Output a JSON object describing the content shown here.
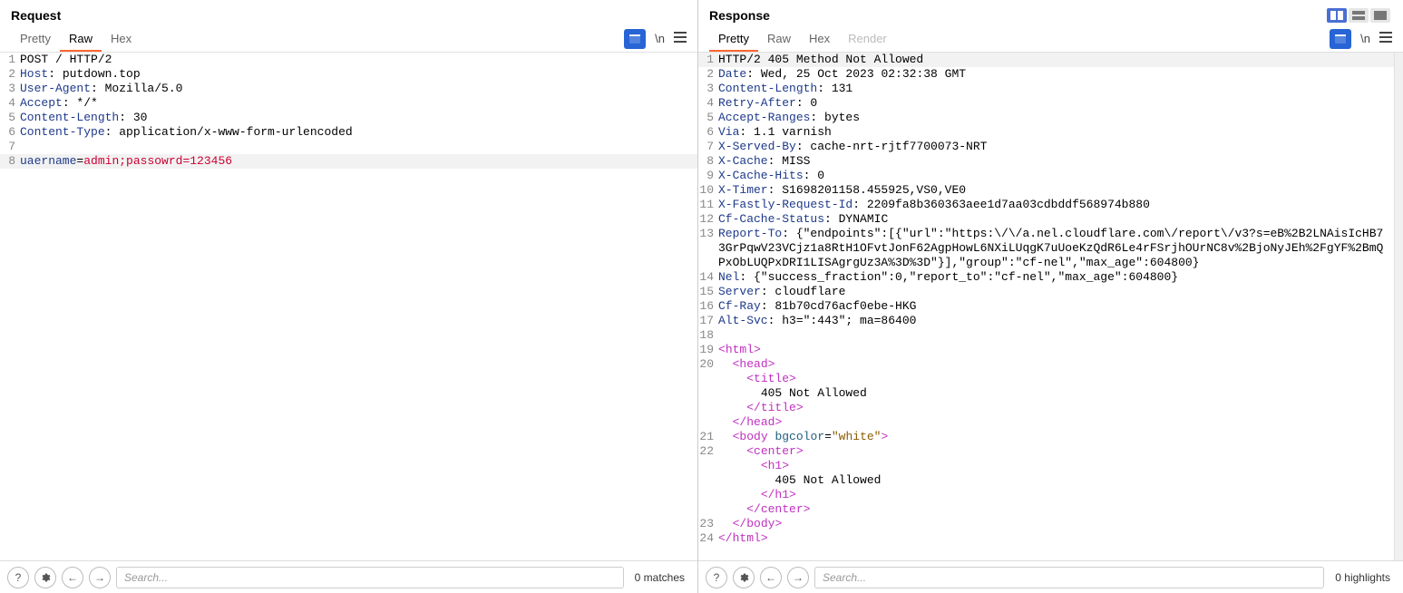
{
  "request": {
    "title": "Request",
    "tabs": [
      "Pretty",
      "Raw",
      "Hex"
    ],
    "activeTab": "Raw",
    "wrapLabel": "\\n",
    "lines": [
      {
        "n": "1",
        "segs": [
          {
            "t": "POST / HTTP/2",
            "c": ""
          }
        ]
      },
      {
        "n": "2",
        "segs": [
          {
            "t": "Host",
            "c": "hdr"
          },
          {
            "t": ": putdown.top",
            "c": ""
          }
        ]
      },
      {
        "n": "3",
        "segs": [
          {
            "t": "User-Agent",
            "c": "hdr"
          },
          {
            "t": ": Mozilla/5.0",
            "c": ""
          }
        ]
      },
      {
        "n": "4",
        "segs": [
          {
            "t": "Accept",
            "c": "hdr"
          },
          {
            "t": ": */*",
            "c": ""
          }
        ]
      },
      {
        "n": "5",
        "segs": [
          {
            "t": "Content-Length",
            "c": "hdr"
          },
          {
            "t": ": 30",
            "c": ""
          }
        ]
      },
      {
        "n": "6",
        "segs": [
          {
            "t": "Content-Type",
            "c": "hdr"
          },
          {
            "t": ": application/x-www-form-urlencoded",
            "c": ""
          }
        ]
      },
      {
        "n": "7",
        "segs": [
          {
            "t": "",
            "c": ""
          }
        ]
      },
      {
        "n": "8",
        "hl": true,
        "segs": [
          {
            "t": "uaername",
            "c": "hdr"
          },
          {
            "t": "=",
            "c": ""
          },
          {
            "t": "admin;passowrd=123456",
            "c": "red"
          }
        ]
      }
    ],
    "searchPlaceholder": "Search...",
    "matches": "0 matches"
  },
  "response": {
    "title": "Response",
    "tabs": [
      "Pretty",
      "Raw",
      "Hex",
      "Render"
    ],
    "activeTab": "Pretty",
    "disabledTab": "Render",
    "wrapLabel": "\\n",
    "lines": [
      {
        "n": "1",
        "hl": true,
        "segs": [
          {
            "t": "HTTP/2 405 Method Not Allowed",
            "c": ""
          }
        ]
      },
      {
        "n": "2",
        "segs": [
          {
            "t": "Date",
            "c": "hdr"
          },
          {
            "t": ": Wed, 25 Oct 2023 02:32:38 GMT",
            "c": ""
          }
        ]
      },
      {
        "n": "3",
        "segs": [
          {
            "t": "Content-Length",
            "c": "hdr"
          },
          {
            "t": ": 131",
            "c": ""
          }
        ]
      },
      {
        "n": "4",
        "segs": [
          {
            "t": "Retry-After",
            "c": "hdr"
          },
          {
            "t": ": 0",
            "c": ""
          }
        ]
      },
      {
        "n": "5",
        "segs": [
          {
            "t": "Accept-Ranges",
            "c": "hdr"
          },
          {
            "t": ": bytes",
            "c": ""
          }
        ]
      },
      {
        "n": "6",
        "segs": [
          {
            "t": "Via",
            "c": "hdr"
          },
          {
            "t": ": 1.1 varnish",
            "c": ""
          }
        ]
      },
      {
        "n": "7",
        "segs": [
          {
            "t": "X-Served-By",
            "c": "hdr"
          },
          {
            "t": ": cache-nrt-rjtf7700073-NRT",
            "c": ""
          }
        ]
      },
      {
        "n": "8",
        "segs": [
          {
            "t": "X-Cache",
            "c": "hdr"
          },
          {
            "t": ": MISS",
            "c": ""
          }
        ]
      },
      {
        "n": "9",
        "segs": [
          {
            "t": "X-Cache-Hits",
            "c": "hdr"
          },
          {
            "t": ": 0",
            "c": ""
          }
        ]
      },
      {
        "n": "10",
        "segs": [
          {
            "t": "X-Timer",
            "c": "hdr"
          },
          {
            "t": ": S1698201158.455925,VS0,VE0",
            "c": ""
          }
        ]
      },
      {
        "n": "11",
        "segs": [
          {
            "t": "X-Fastly-Request-Id",
            "c": "hdr"
          },
          {
            "t": ": 2209fa8b360363aee1d7aa03cdbddf568974b880",
            "c": ""
          }
        ]
      },
      {
        "n": "12",
        "segs": [
          {
            "t": "Cf-Cache-Status",
            "c": "hdr"
          },
          {
            "t": ": DYNAMIC",
            "c": ""
          }
        ]
      },
      {
        "n": "13",
        "segs": [
          {
            "t": "Report-To",
            "c": "hdr"
          },
          {
            "t": ": {\"endpoints\":[{\"url\":\"https:\\/\\/a.nel.cloudflare.com\\/report\\/v3?s=eB%2B2LNAisIcHB73GrPqwV23VCjz1a8RtH1OFvtJonF62AgpHowL6NXiLUqgK7uUoeKzQdR6Le4rFSrjhOUrNC8v%2BjoNyJEh%2FgYF%2BmQPxObLUQPxDRI1LISAgrgUz3A%3D%3D\"}],\"group\":\"cf-nel\",\"max_age\":604800}",
            "c": ""
          }
        ]
      },
      {
        "n": "14",
        "segs": [
          {
            "t": "Nel",
            "c": "hdr"
          },
          {
            "t": ": {\"success_fraction\":0,\"report_to\":\"cf-nel\",\"max_age\":604800}",
            "c": ""
          }
        ]
      },
      {
        "n": "15",
        "segs": [
          {
            "t": "Server",
            "c": "hdr"
          },
          {
            "t": ": cloudflare",
            "c": ""
          }
        ]
      },
      {
        "n": "16",
        "segs": [
          {
            "t": "Cf-Ray",
            "c": "hdr"
          },
          {
            "t": ": 81b70cd76acf0ebe-HKG",
            "c": ""
          }
        ]
      },
      {
        "n": "17",
        "segs": [
          {
            "t": "Alt-Svc",
            "c": "hdr"
          },
          {
            "t": ": h3=\":443\"; ma=86400",
            "c": ""
          }
        ]
      },
      {
        "n": "18",
        "segs": [
          {
            "t": "",
            "c": ""
          }
        ]
      },
      {
        "n": "19",
        "segs": [
          {
            "t": "<",
            "c": "tag"
          },
          {
            "t": "html",
            "c": "tag"
          },
          {
            "t": ">",
            "c": "tag"
          }
        ]
      },
      {
        "n": "20",
        "segs": [
          {
            "t": "  <",
            "c": "tag"
          },
          {
            "t": "head",
            "c": "tag"
          },
          {
            "t": ">",
            "c": "tag"
          }
        ]
      },
      {
        "n": "",
        "segs": [
          {
            "t": "    <",
            "c": "tag"
          },
          {
            "t": "title",
            "c": "tag"
          },
          {
            "t": ">",
            "c": "tag"
          }
        ]
      },
      {
        "n": "",
        "segs": [
          {
            "t": "      405 Not Allowed",
            "c": ""
          }
        ]
      },
      {
        "n": "",
        "segs": [
          {
            "t": "    </",
            "c": "tag"
          },
          {
            "t": "title",
            "c": "tag"
          },
          {
            "t": ">",
            "c": "tag"
          }
        ]
      },
      {
        "n": "",
        "segs": [
          {
            "t": "  </",
            "c": "tag"
          },
          {
            "t": "head",
            "c": "tag"
          },
          {
            "t": ">",
            "c": "tag"
          }
        ]
      },
      {
        "n": "21",
        "segs": [
          {
            "t": "  <",
            "c": "tag"
          },
          {
            "t": "body",
            "c": "tag"
          },
          {
            "t": " ",
            "c": ""
          },
          {
            "t": "bgcolor",
            "c": "attr"
          },
          {
            "t": "=",
            "c": ""
          },
          {
            "t": "\"white\"",
            "c": "str"
          },
          {
            "t": ">",
            "c": "tag"
          }
        ]
      },
      {
        "n": "22",
        "segs": [
          {
            "t": "    <",
            "c": "tag"
          },
          {
            "t": "center",
            "c": "tag"
          },
          {
            "t": ">",
            "c": "tag"
          }
        ]
      },
      {
        "n": "",
        "segs": [
          {
            "t": "      <",
            "c": "tag"
          },
          {
            "t": "h1",
            "c": "tag"
          },
          {
            "t": ">",
            "c": "tag"
          }
        ]
      },
      {
        "n": "",
        "segs": [
          {
            "t": "        405 Not Allowed",
            "c": ""
          }
        ]
      },
      {
        "n": "",
        "segs": [
          {
            "t": "      </",
            "c": "tag"
          },
          {
            "t": "h1",
            "c": "tag"
          },
          {
            "t": ">",
            "c": "tag"
          }
        ]
      },
      {
        "n": "",
        "segs": [
          {
            "t": "    </",
            "c": "tag"
          },
          {
            "t": "center",
            "c": "tag"
          },
          {
            "t": ">",
            "c": "tag"
          }
        ]
      },
      {
        "n": "23",
        "segs": [
          {
            "t": "  </",
            "c": "tag"
          },
          {
            "t": "body",
            "c": "tag"
          },
          {
            "t": ">",
            "c": "tag"
          }
        ]
      },
      {
        "n": "24",
        "segs": [
          {
            "t": "</",
            "c": "tag"
          },
          {
            "t": "html",
            "c": "tag"
          },
          {
            "t": ">",
            "c": "tag"
          }
        ]
      }
    ],
    "searchPlaceholder": "Search...",
    "matches": "0 highlights"
  }
}
